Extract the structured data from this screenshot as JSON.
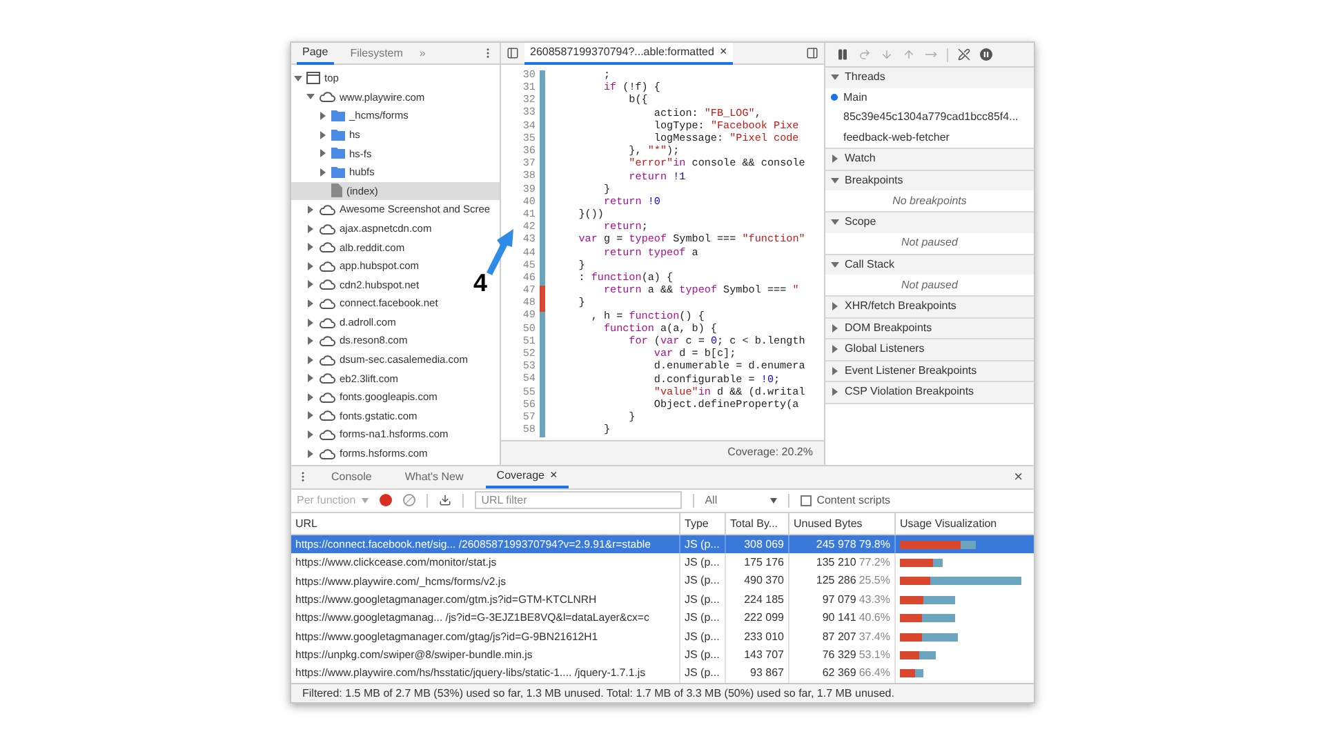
{
  "navigator": {
    "tabs": [
      {
        "label": "Page",
        "selected": true
      },
      {
        "label": "Filesystem",
        "selected": false
      }
    ],
    "more": "»",
    "tree": [
      {
        "kind": "frame",
        "label": "top",
        "expanded": true,
        "selected": false,
        "children": [
          {
            "kind": "domain",
            "label": "www.playwire.com",
            "expanded": true,
            "selected": false,
            "children": [
              {
                "kind": "folder",
                "label": "_hcms/forms",
                "expanded": false,
                "selected": false
              },
              {
                "kind": "folder",
                "label": "hs",
                "expanded": false,
                "selected": false
              },
              {
                "kind": "folder",
                "label": "hs-fs",
                "expanded": false,
                "selected": false
              },
              {
                "kind": "folder",
                "label": "hubfs",
                "expanded": false,
                "selected": false
              },
              {
                "kind": "file",
                "label": "(index)",
                "selected": true
              }
            ]
          },
          {
            "kind": "domain",
            "label": "Awesome Screenshot and Scree",
            "expanded": false,
            "selected": false
          },
          {
            "kind": "domain",
            "label": "ajax.aspnetcdn.com",
            "expanded": false,
            "selected": false
          },
          {
            "kind": "domain",
            "label": "alb.reddit.com",
            "expanded": false,
            "selected": false
          },
          {
            "kind": "domain",
            "label": "app.hubspot.com",
            "expanded": false,
            "selected": false
          },
          {
            "kind": "domain",
            "label": "cdn2.hubspot.net",
            "expanded": false,
            "selected": false
          },
          {
            "kind": "domain",
            "label": "connect.facebook.net",
            "expanded": false,
            "selected": false
          },
          {
            "kind": "domain",
            "label": "d.adroll.com",
            "expanded": false,
            "selected": false
          },
          {
            "kind": "domain",
            "label": "ds.reson8.com",
            "expanded": false,
            "selected": false
          },
          {
            "kind": "domain",
            "label": "dsum-sec.casalemedia.com",
            "expanded": false,
            "selected": false
          },
          {
            "kind": "domain",
            "label": "eb2.3lift.com",
            "expanded": false,
            "selected": false
          },
          {
            "kind": "domain",
            "label": "fonts.googleapis.com",
            "expanded": false,
            "selected": false
          },
          {
            "kind": "domain",
            "label": "fonts.gstatic.com",
            "expanded": false,
            "selected": false
          },
          {
            "kind": "domain",
            "label": "forms-na1.hsforms.com",
            "expanded": false,
            "selected": false
          },
          {
            "kind": "domain",
            "label": "forms.hsforms.com",
            "expanded": false,
            "selected": false
          }
        ]
      }
    ]
  },
  "editor": {
    "tab": {
      "title": "2608587199370794?...able:formatted",
      "close": "×"
    },
    "coverage": "Coverage: 20.2%",
    "lines": [
      {
        "number": "30",
        "covered": true,
        "segments": [
          {
            "kind": "plain",
            "text": "        ;"
          }
        ]
      },
      {
        "number": "31",
        "covered": true,
        "segments": [
          {
            "kind": "keyword",
            "text": "        if"
          },
          {
            "kind": "plain",
            "text": " (!f) {"
          }
        ]
      },
      {
        "number": "32",
        "covered": true,
        "segments": [
          {
            "kind": "plain",
            "text": "            b({"
          }
        ]
      },
      {
        "number": "33",
        "covered": true,
        "segments": [
          {
            "kind": "plain",
            "text": "                action: "
          },
          {
            "kind": "string",
            "text": "\"FB_LOG\""
          },
          {
            "kind": "plain",
            "text": ","
          }
        ]
      },
      {
        "number": "34",
        "covered": true,
        "segments": [
          {
            "kind": "plain",
            "text": "                logType: "
          },
          {
            "kind": "string",
            "text": "\"Facebook Pixe"
          }
        ]
      },
      {
        "number": "35",
        "covered": true,
        "segments": [
          {
            "kind": "plain",
            "text": "                logMessage: "
          },
          {
            "kind": "string",
            "text": "\"Pixel code"
          }
        ]
      },
      {
        "number": "36",
        "covered": true,
        "segments": [
          {
            "kind": "plain",
            "text": "            }, "
          },
          {
            "kind": "string",
            "text": "\"*\""
          },
          {
            "kind": "plain",
            "text": ");"
          }
        ]
      },
      {
        "number": "37",
        "covered": true,
        "segments": [
          {
            "kind": "string",
            "text": "            \"error\""
          },
          {
            "kind": "keyword",
            "text": "in"
          },
          {
            "kind": "plain",
            "text": " console && console"
          }
        ]
      },
      {
        "number": "38",
        "covered": true,
        "segments": [
          {
            "kind": "keyword",
            "text": "            return"
          },
          {
            "kind": "number",
            "text": " !1"
          }
        ]
      },
      {
        "number": "39",
        "covered": true,
        "segments": [
          {
            "kind": "plain",
            "text": "        }"
          }
        ]
      },
      {
        "number": "40",
        "covered": true,
        "segments": [
          {
            "kind": "keyword",
            "text": "        return"
          },
          {
            "kind": "number",
            "text": " !0"
          }
        ]
      },
      {
        "number": "41",
        "covered": true,
        "segments": [
          {
            "kind": "plain",
            "text": "    }())"
          }
        ]
      },
      {
        "number": "42",
        "covered": true,
        "segments": [
          {
            "kind": "keyword",
            "text": "        return"
          },
          {
            "kind": "plain",
            "text": ";"
          }
        ]
      },
      {
        "number": "43",
        "covered": true,
        "segments": [
          {
            "kind": "keyword",
            "text": "    var"
          },
          {
            "kind": "plain",
            "text": " g = "
          },
          {
            "kind": "keyword",
            "text": "typeof"
          },
          {
            "kind": "plain",
            "text": " Symbol === "
          },
          {
            "kind": "string",
            "text": "\"function\""
          }
        ]
      },
      {
        "number": "44",
        "covered": true,
        "segments": [
          {
            "kind": "keyword",
            "text": "        return typeof"
          },
          {
            "kind": "plain",
            "text": " a"
          }
        ]
      },
      {
        "number": "45",
        "covered": true,
        "segments": [
          {
            "kind": "plain",
            "text": "    }"
          }
        ]
      },
      {
        "number": "46",
        "covered": true,
        "segments": [
          {
            "kind": "plain",
            "text": "    : "
          },
          {
            "kind": "keyword",
            "text": "function"
          },
          {
            "kind": "plain",
            "text": "(a) {"
          }
        ]
      },
      {
        "number": "47",
        "covered": false,
        "segments": [
          {
            "kind": "keyword",
            "text": "        return"
          },
          {
            "kind": "plain",
            "text": " a && "
          },
          {
            "kind": "keyword",
            "text": "typeof"
          },
          {
            "kind": "plain",
            "text": " Symbol === "
          },
          {
            "kind": "string",
            "text": "\""
          }
        ]
      },
      {
        "number": "48",
        "covered": false,
        "segments": [
          {
            "kind": "plain",
            "text": "    }"
          }
        ]
      },
      {
        "number": "49",
        "covered": true,
        "segments": [
          {
            "kind": "plain",
            "text": "      , h = "
          },
          {
            "kind": "keyword",
            "text": "function"
          },
          {
            "kind": "plain",
            "text": "() {"
          }
        ]
      },
      {
        "number": "50",
        "covered": true,
        "segments": [
          {
            "kind": "keyword",
            "text": "        function"
          },
          {
            "kind": "plain",
            "text": " a(a, b) {"
          }
        ]
      },
      {
        "number": "51",
        "covered": true,
        "segments": [
          {
            "kind": "keyword",
            "text": "            for"
          },
          {
            "kind": "plain",
            "text": " ("
          },
          {
            "kind": "keyword",
            "text": "var"
          },
          {
            "kind": "plain",
            "text": " c = "
          },
          {
            "kind": "number",
            "text": "0"
          },
          {
            "kind": "plain",
            "text": "; c < b.length"
          }
        ]
      },
      {
        "number": "52",
        "covered": true,
        "segments": [
          {
            "kind": "keyword",
            "text": "                var"
          },
          {
            "kind": "plain",
            "text": " d = b[c];"
          }
        ]
      },
      {
        "number": "53",
        "covered": true,
        "segments": [
          {
            "kind": "plain",
            "text": "                d.enumerable = d.enumera"
          }
        ]
      },
      {
        "number": "54",
        "covered": true,
        "segments": [
          {
            "kind": "plain",
            "text": "                d.configurable = "
          },
          {
            "kind": "number",
            "text": "!0"
          },
          {
            "kind": "plain",
            "text": ";"
          }
        ]
      },
      {
        "number": "55",
        "covered": true,
        "segments": [
          {
            "kind": "string",
            "text": "                \"value\""
          },
          {
            "kind": "keyword",
            "text": "in"
          },
          {
            "kind": "plain",
            "text": " d && (d.writal"
          }
        ]
      },
      {
        "number": "56",
        "covered": true,
        "segments": [
          {
            "kind": "plain",
            "text": "                Object.defineProperty(a"
          }
        ]
      },
      {
        "number": "57",
        "covered": true,
        "segments": [
          {
            "kind": "plain",
            "text": "            }"
          }
        ]
      },
      {
        "number": "58",
        "covered": true,
        "segments": [
          {
            "kind": "plain",
            "text": "        }"
          }
        ]
      }
    ]
  },
  "debugger": {
    "sections": [
      {
        "title": "Threads",
        "expanded": true,
        "threads": [
          {
            "name": "Main",
            "selected": true
          },
          {
            "name": "85c39e45c1304a779cad1bcc85f4...",
            "selected": false
          },
          {
            "name": "feedback-web-fetcher",
            "selected": false
          }
        ]
      },
      {
        "title": "Watch",
        "expanded": false
      },
      {
        "title": "Breakpoints",
        "expanded": true,
        "message": "No breakpoints"
      },
      {
        "title": "Scope",
        "expanded": true,
        "message": "Not paused"
      },
      {
        "title": "Call Stack",
        "expanded": true,
        "message": "Not paused"
      },
      {
        "title": "XHR/fetch Breakpoints",
        "expanded": false
      },
      {
        "title": "DOM Breakpoints",
        "expanded": false
      },
      {
        "title": "Global Listeners",
        "expanded": false
      },
      {
        "title": "Event Listener Breakpoints",
        "expanded": false
      },
      {
        "title": "CSP Violation Breakpoints",
        "expanded": false
      }
    ]
  },
  "drawer": {
    "tabs": [
      {
        "label": "Console",
        "selected": false,
        "closable": false
      },
      {
        "label": "What's New",
        "selected": false,
        "closable": false
      },
      {
        "label": "Coverage",
        "selected": true,
        "closable": true
      }
    ],
    "tab_close": "×",
    "close": "×",
    "toolbar": {
      "mode": "Per function",
      "mode_disabled": true,
      "recording": true,
      "url_filter": {
        "placeholder": "URL filter"
      },
      "type_filter": "All",
      "content_scripts": {
        "label": "Content scripts",
        "checked": false
      }
    },
    "table": {
      "columns": [
        "URL",
        "Type",
        "Total By...",
        "Unused Bytes",
        "Usage Visualization"
      ],
      "rows": [
        {
          "url": "https://connect.facebook.net/sig... /2608587199370794?v=2.9.91&r=stable",
          "type": "JS (p...",
          "total": "308 069",
          "unused": "245 978",
          "percent": "79.8%",
          "selected": true,
          "unused_bar": {
            "level": 0.502
          },
          "total_bar": {
            "level": 0.628
          }
        },
        {
          "url": "https://www.clickcease.com/monitor/stat.js",
          "type": "JS (p...",
          "total": "175 176",
          "unused": "135 210",
          "percent": "77.2%",
          "selected": false,
          "unused_bar": {
            "level": 0.276
          },
          "total_bar": {
            "level": 0.357
          }
        },
        {
          "url": "https://www.playwire.com/_hcms/forms/v2.js",
          "type": "JS (p...",
          "total": "490 370",
          "unused": "125 286",
          "percent": "25.5%",
          "selected": false,
          "unused_bar": {
            "level": 0.255
          },
          "total_bar": {
            "level": 1
          }
        },
        {
          "url": "https://www.googletagmanager.com/gtm.js?id=GTM-KTCLNRH",
          "type": "JS (p...",
          "total": "224 185",
          "unused": "97 079",
          "percent": "43.3%",
          "selected": false,
          "unused_bar": {
            "level": 0.198
          },
          "total_bar": {
            "level": 0.457
          }
        },
        {
          "url": "https://www.googletagmanag... /js?id=G-3EJZ1BE8VQ&l=dataLayer&cx=c",
          "type": "JS (p...",
          "total": "222 099",
          "unused": "90 141",
          "percent": "40.6%",
          "selected": false,
          "unused_bar": {
            "level": 0.184
          },
          "total_bar": {
            "level": 0.453
          }
        },
        {
          "url": "https://www.googletagmanager.com/gtag/js?id=G-9BN21612H1",
          "type": "JS (p...",
          "total": "233 010",
          "unused": "87 207",
          "percent": "37.4%",
          "selected": false,
          "unused_bar": {
            "level": 0.178
          },
          "total_bar": {
            "level": 0.475
          }
        },
        {
          "url": "https://unpkg.com/swiper@8/swiper-bundle.min.js",
          "type": "JS (p...",
          "total": "143 707",
          "unused": "76 329",
          "percent": "53.1%",
          "selected": false,
          "unused_bar": {
            "level": 0.156
          },
          "total_bar": {
            "level": 0.293
          }
        },
        {
          "url": "https://www.playwire.com/hs/hsstatic/jquery-libs/static-1.... /jquery-1.7.1.js",
          "type": "JS (p...",
          "total": "93 867",
          "unused": "62 369",
          "percent": "66.4%",
          "selected": false,
          "unused_bar": {
            "level": 0.127
          },
          "total_bar": {
            "level": 0.191
          }
        }
      ]
    },
    "status": "Filtered: 1.5 MB of 2.7 MB (53%) used so far, 1.3 MB unused. Total: 1.7 MB of 3.3 MB (50%) used so far, 1.7 MB unused."
  },
  "annotation": {
    "label": "4"
  }
}
